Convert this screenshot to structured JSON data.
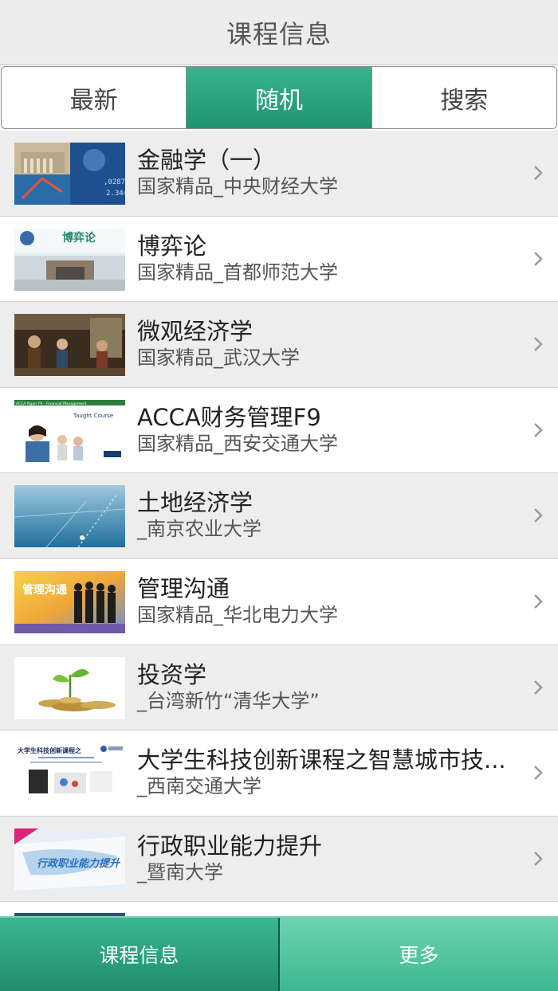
{
  "header": {
    "title": "课程信息"
  },
  "tabs": [
    {
      "label": "最新",
      "active": false
    },
    {
      "label": "随机",
      "active": true
    },
    {
      "label": "搜索",
      "active": false
    }
  ],
  "courses": [
    {
      "title": "金融学（一）",
      "subtitle": "国家精品_中央财经大学",
      "thumb_icon": "finance-building-thumb"
    },
    {
      "title": "博弈论",
      "subtitle": "国家精品_首都师范大学",
      "thumb_icon": "game-theory-gate-thumb",
      "thumb_text": "博弈论"
    },
    {
      "title": "微观经济学",
      "subtitle": "国家精品_武汉大学",
      "thumb_icon": "oil-painting-thumb"
    },
    {
      "title": "ACCA财务管理F9",
      "subtitle": "国家精品_西安交通大学",
      "thumb_icon": "acca-slide-thumb",
      "thumb_text": "ACCA Paper F9 - Financial Management",
      "thumb_text2": "Taught Course"
    },
    {
      "title": "土地经济学",
      "subtitle": "_南京农业大学",
      "thumb_icon": "blue-field-thumb"
    },
    {
      "title": "管理沟通",
      "subtitle": "国家精品_华北电力大学",
      "thumb_icon": "business-team-thumb",
      "thumb_text": "管理沟通"
    },
    {
      "title": "投资学",
      "subtitle": "_台湾新竹“清华大学”",
      "thumb_icon": "plant-coins-thumb"
    },
    {
      "title": "大学生科技创新课程之智慧城市技...",
      "subtitle": "_西南交通大学",
      "thumb_icon": "innovation-slide-thumb",
      "thumb_text": "大学生科技创新课程之"
    },
    {
      "title": "行政职业能力提升",
      "subtitle": "_暨南大学",
      "thumb_icon": "admin-skills-thumb",
      "thumb_text": "行政职业能力提升"
    }
  ],
  "bottom_nav": [
    {
      "label": "课程信息",
      "active": true
    },
    {
      "label": "更多",
      "active": false
    }
  ],
  "colors": {
    "accent": "#26a07b",
    "accent_light": "#5ccaa6"
  }
}
